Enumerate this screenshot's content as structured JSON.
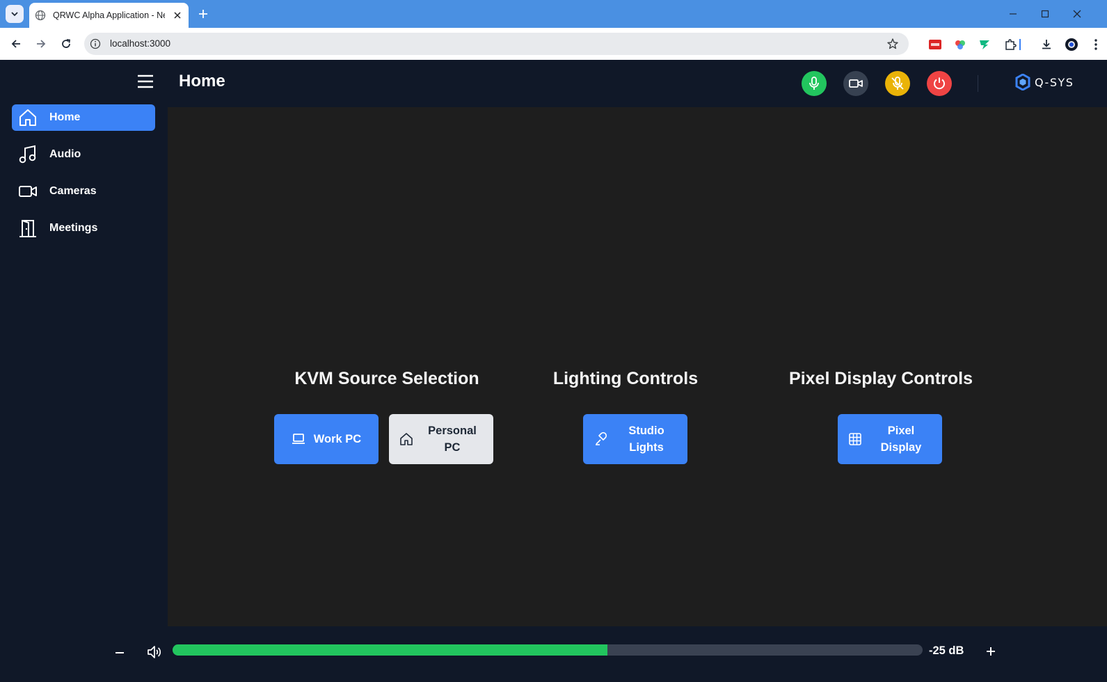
{
  "browser": {
    "tab_title": "QRWC Alpha Application - Next.js",
    "url": "localhost:3000",
    "icons": [
      "tab-list-icon",
      "globe-icon",
      "close-icon",
      "plus-icon",
      "minimize-icon",
      "maximize-icon",
      "close-window-icon",
      "back-icon",
      "forward-icon",
      "reload-icon",
      "info-icon",
      "star-icon",
      "extension-red-icon",
      "extension-color-icon",
      "extension-green-icon",
      "extensions-puzzle-icon",
      "download-icon",
      "profile-icon",
      "menu-dots-icon"
    ]
  },
  "header": {
    "page_title": "Home",
    "buttons": [
      {
        "name": "mic",
        "color": "#22c55e"
      },
      {
        "name": "camera",
        "color": "#374151"
      },
      {
        "name": "privacy-mute",
        "color": "#eab308"
      },
      {
        "name": "power",
        "color": "#ef4444"
      }
    ],
    "logo_text": "Q-SYS"
  },
  "sidebar": {
    "items": [
      {
        "label": "Home",
        "icon": "home-icon",
        "active": true
      },
      {
        "label": "Audio",
        "icon": "music-icon",
        "active": false
      },
      {
        "label": "Cameras",
        "icon": "video-camera-icon",
        "active": false
      },
      {
        "label": "Meetings",
        "icon": "door-icon",
        "active": false
      }
    ]
  },
  "main": {
    "sections": [
      {
        "title": "KVM Source Selection",
        "buttons": [
          {
            "label": "Work PC",
            "icon": "laptop-icon",
            "selected": true
          },
          {
            "label": "Personal PC",
            "icon": "home-icon",
            "selected": false
          }
        ]
      },
      {
        "title": "Lighting Controls",
        "buttons": [
          {
            "label": "Studio Lights",
            "icon": "lamp-icon",
            "selected": true
          }
        ]
      },
      {
        "title": "Pixel Display Controls",
        "buttons": [
          {
            "label": "Pixel Display",
            "icon": "grid-icon",
            "selected": true
          }
        ]
      }
    ]
  },
  "volume": {
    "level_fraction": 0.58,
    "db_label": "-25 dB",
    "fill_color": "#22c55e"
  }
}
